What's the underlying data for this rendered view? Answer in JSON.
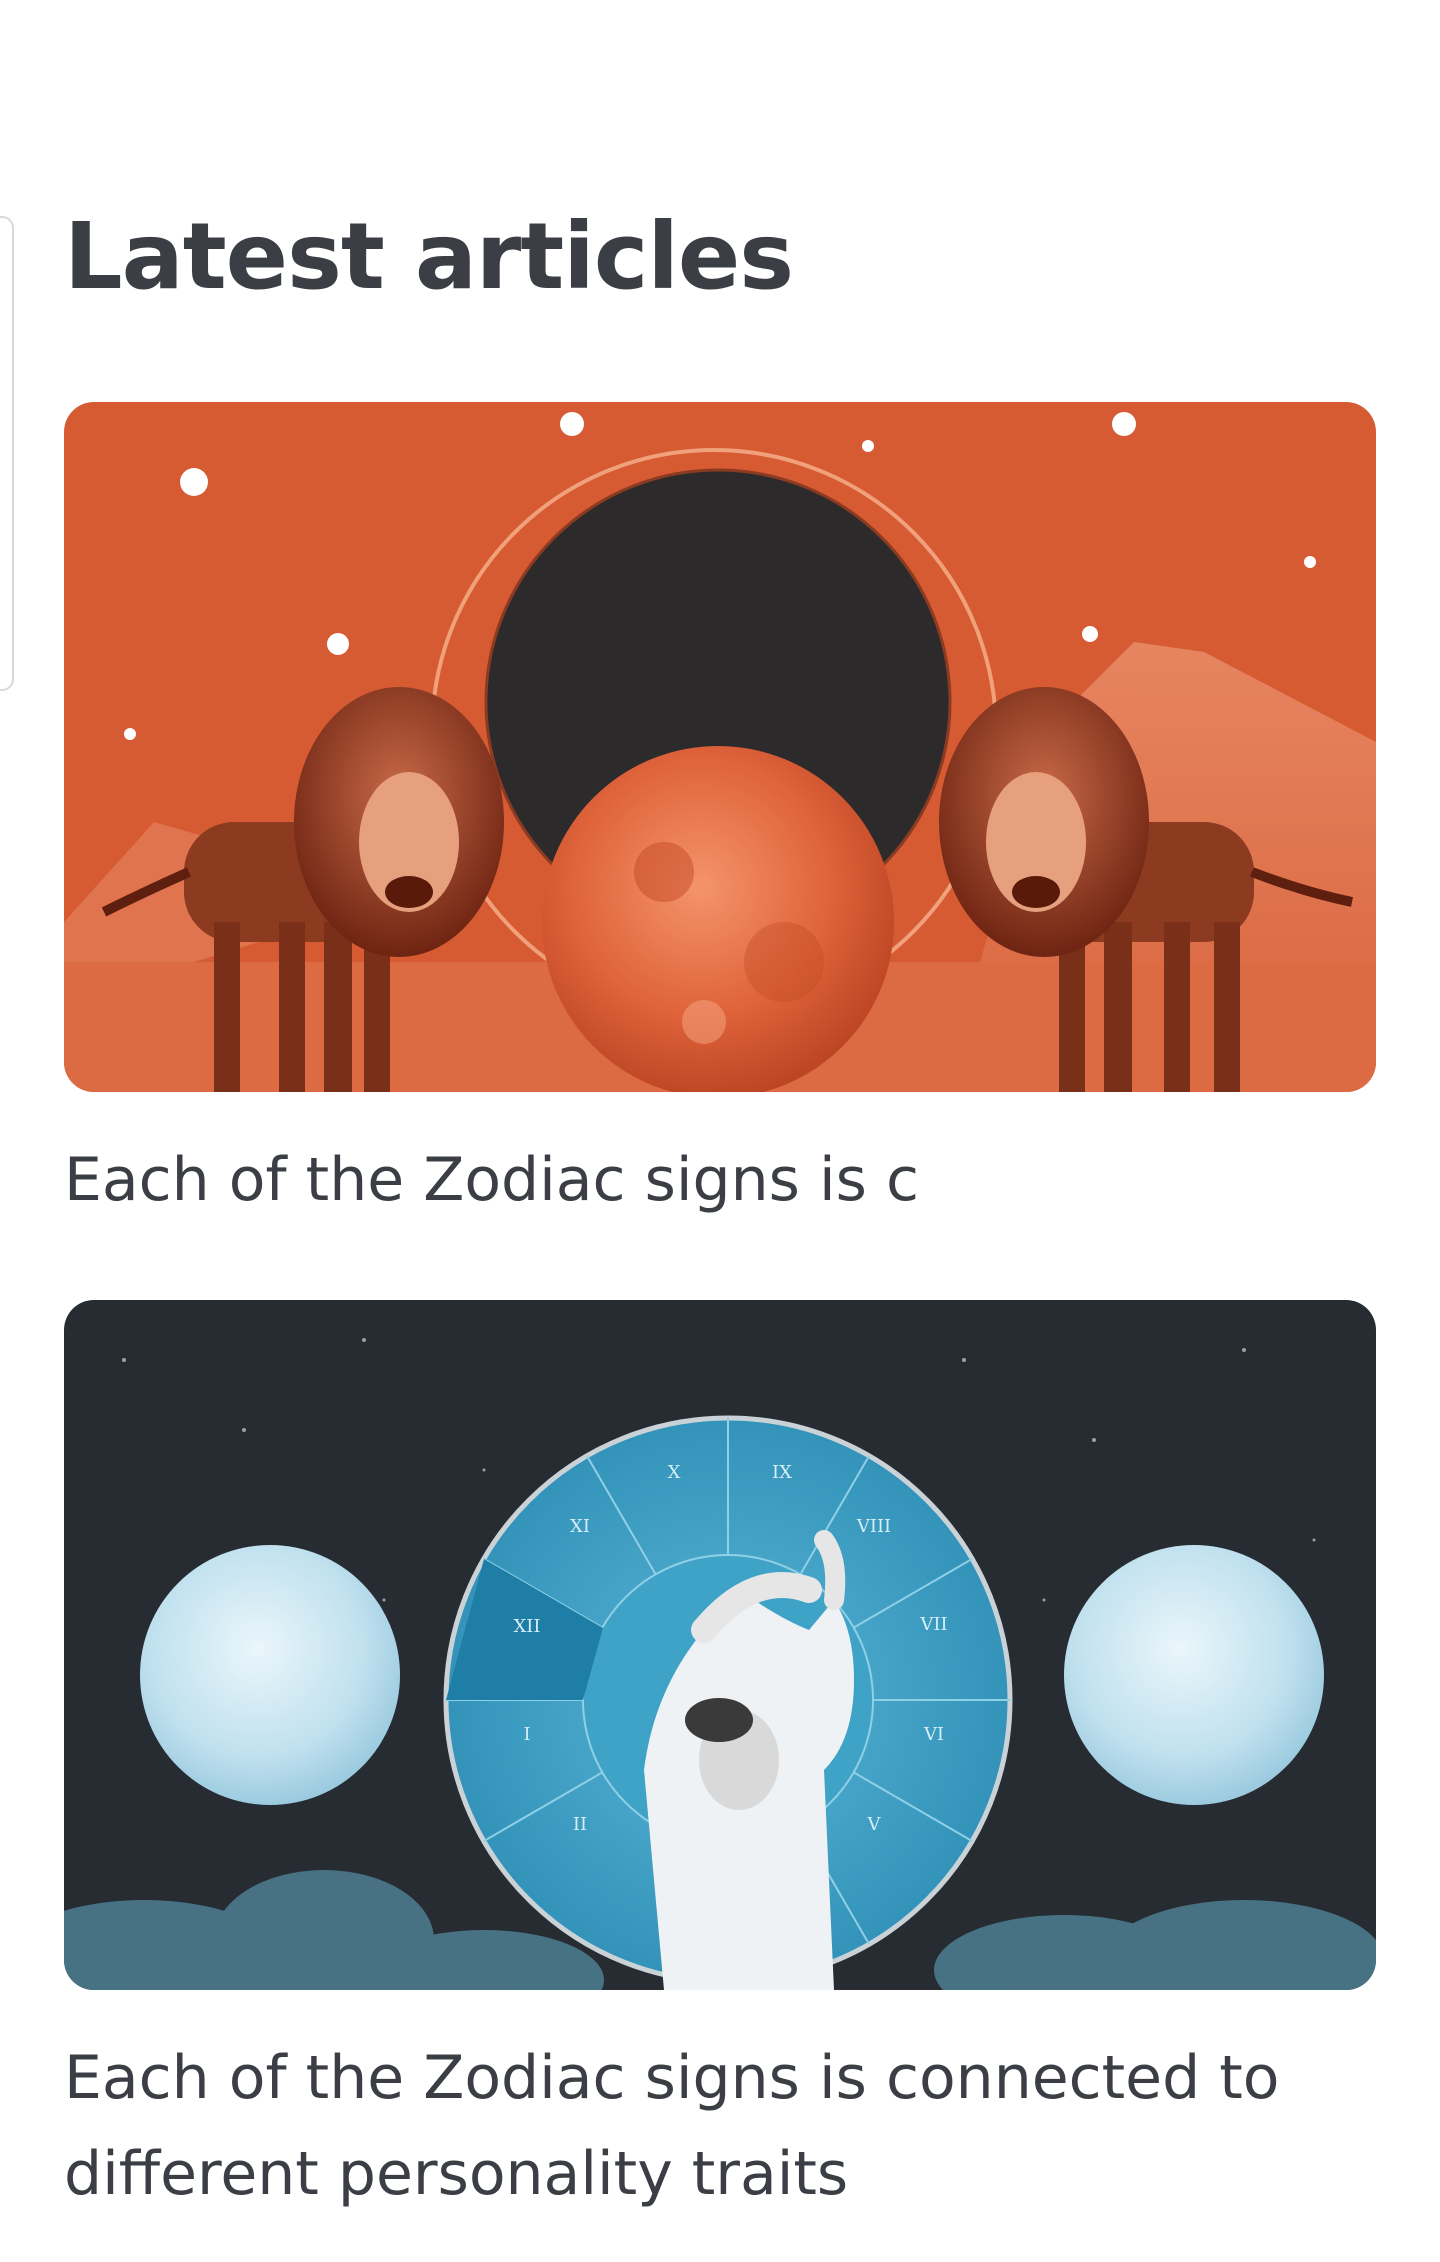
{
  "page": {
    "title": "Latest articles"
  },
  "articles": [
    {
      "image": "leo-lions-eclipse-illustration",
      "excerpt": "Each of the Zodiac signs is c"
    },
    {
      "image": "zodiac-wheel-moons-illustration",
      "excerpt": "Each of the Zodiac signs is connected to different personality traits"
    }
  ],
  "wheel": {
    "numerals": [
      "X",
      "IX",
      "VIII",
      "VII",
      "VI",
      "V",
      "XI",
      "XII",
      "I",
      "II"
    ]
  },
  "colors": {
    "text": "#3b3f45",
    "leo_background": "#d65a32",
    "night_background": "#262c31",
    "wheel_blue": "#3e9fc2"
  }
}
